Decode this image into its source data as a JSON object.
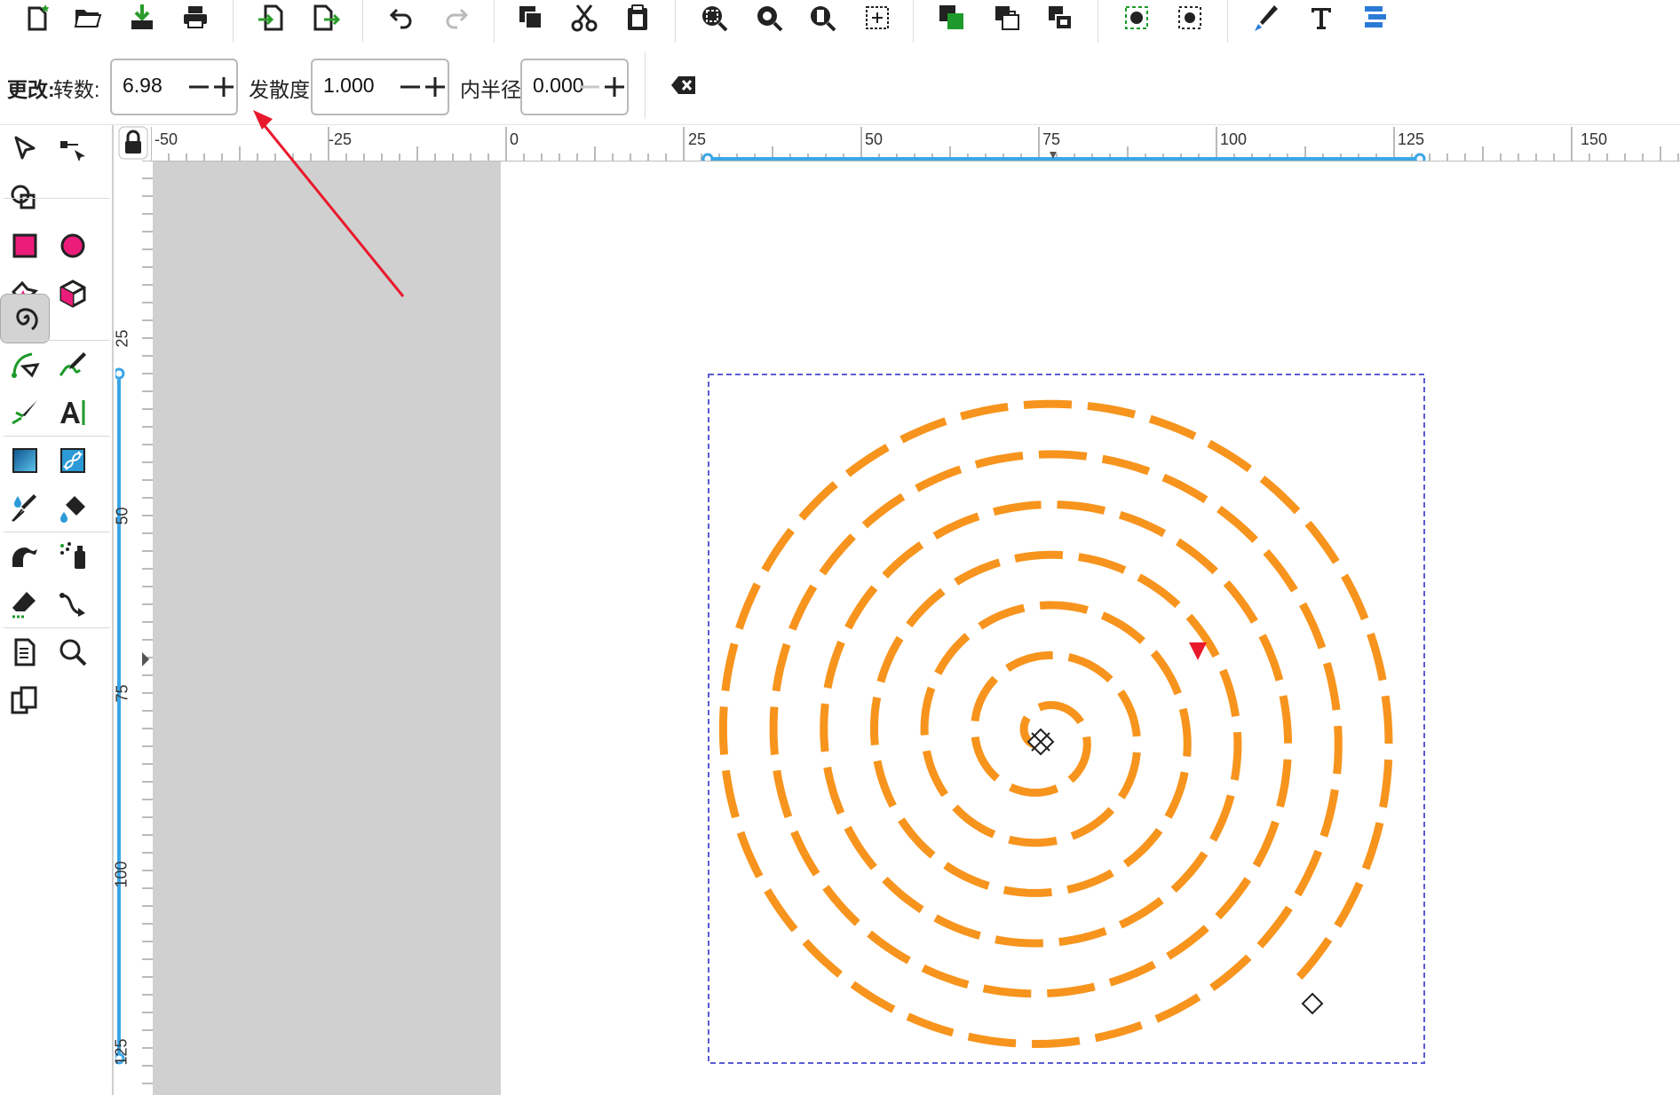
{
  "toolbar": {
    "buttons": [
      "new-document",
      "open",
      "import",
      "print",
      "import-page",
      "export",
      "undo",
      "redo",
      "copy",
      "cut",
      "paste",
      "zoom-selection",
      "zoom-drawing",
      "zoom-page",
      "zoom-center",
      "raise-to-top",
      "lock-layer",
      "unlock-layer",
      "select-node",
      "select-object",
      "pen-tool",
      "text-tool",
      "align"
    ]
  },
  "spiral_controls": {
    "change_label": "更改:",
    "turns_label": "转数:",
    "turns_value": "6.98",
    "divergence_label": "发散度:",
    "divergence_value": "1.000",
    "inner_radius_label": "内半径:",
    "inner_radius_value": "0.000",
    "reset_button": "clear-reset"
  },
  "rulers": {
    "horizontal_labels": [
      "-50",
      "-25",
      "0",
      "25",
      "50",
      "75",
      "100",
      "125",
      "150"
    ],
    "vertical_labels": [
      "25",
      "50",
      "75",
      "100",
      "125"
    ]
  },
  "tools": [
    "selector",
    "node",
    "shape-builder",
    "rectangle",
    "ellipse",
    "star",
    "3d-box",
    "spiral",
    "bezier-pen",
    "pencil",
    "calligraphy",
    "text",
    "gradient",
    "mesh",
    "dropper",
    "paint-bucket",
    "tweak",
    "spray",
    "eraser",
    "connector",
    "pages",
    "zoom",
    "clone"
  ],
  "active_tool": "spiral",
  "colors": {
    "spiral_stroke": "#f7941d",
    "ruler_selection": "#3aa6e8",
    "bbox_dash": "#5b5bd6",
    "annotation_arrow": "#e8192c",
    "desk": "#d0d0d0",
    "active_tool_bg": "#d3d3d3"
  }
}
